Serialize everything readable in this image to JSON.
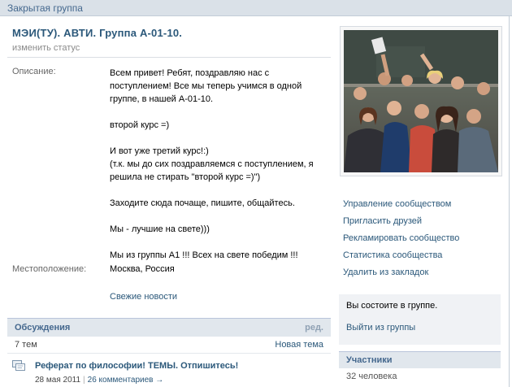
{
  "header": {
    "group_type": "Закрытая группа"
  },
  "group": {
    "title": "МЭИ(ТУ). АВТИ. Группа А-01-10.",
    "status_link": "изменить статус",
    "description_label": "Описание:",
    "description_lines": [
      "Всем привет! Ребят, поздравляю нас с",
      "поступлением! Все мы теперь учимся в одной",
      "группе, в нашей А-01-10.",
      "",
      "второй курс =)",
      "",
      "И вот уже третий курс!:)",
      "(т.к. мы до сих поздравляемся с поступлением, я",
      "решила не стирать \"второй курс =)\")",
      "",
      "Заходите сюда почаще, пишите, общайтесь.",
      "",
      "Мы - лучшие на свете)))",
      "",
      "Мы из группы А1 !!! Всех на свете победим !!!"
    ],
    "location_label": "Местоположение:",
    "location_value": "Москва, Россия",
    "fresh_news": "Свежие новости"
  },
  "discussions": {
    "title": "Обсуждения",
    "edit": "ред.",
    "count": "7 тем",
    "new_topic": "Новая тема",
    "topics": [
      {
        "title": "Реферат по философии! ТЕМЫ. Отпишитесь!",
        "date": "28 мая 2011",
        "comments": "26 комментариев →"
      }
    ]
  },
  "sidebar": {
    "actions": [
      "Управление сообществом",
      "Пригласить друзей",
      "Рекламировать сообщество",
      "Статистика сообщества",
      "Удалить из закладок"
    ],
    "membership_status": "Вы состоите в группе.",
    "leave_group": "Выйти из группы",
    "participants_title": "Участники",
    "participants_count": "32 человека"
  },
  "colors": {
    "link": "#2b587a",
    "header_bg": "#e1e7ed",
    "topbar_bg": "#dae1e8"
  }
}
